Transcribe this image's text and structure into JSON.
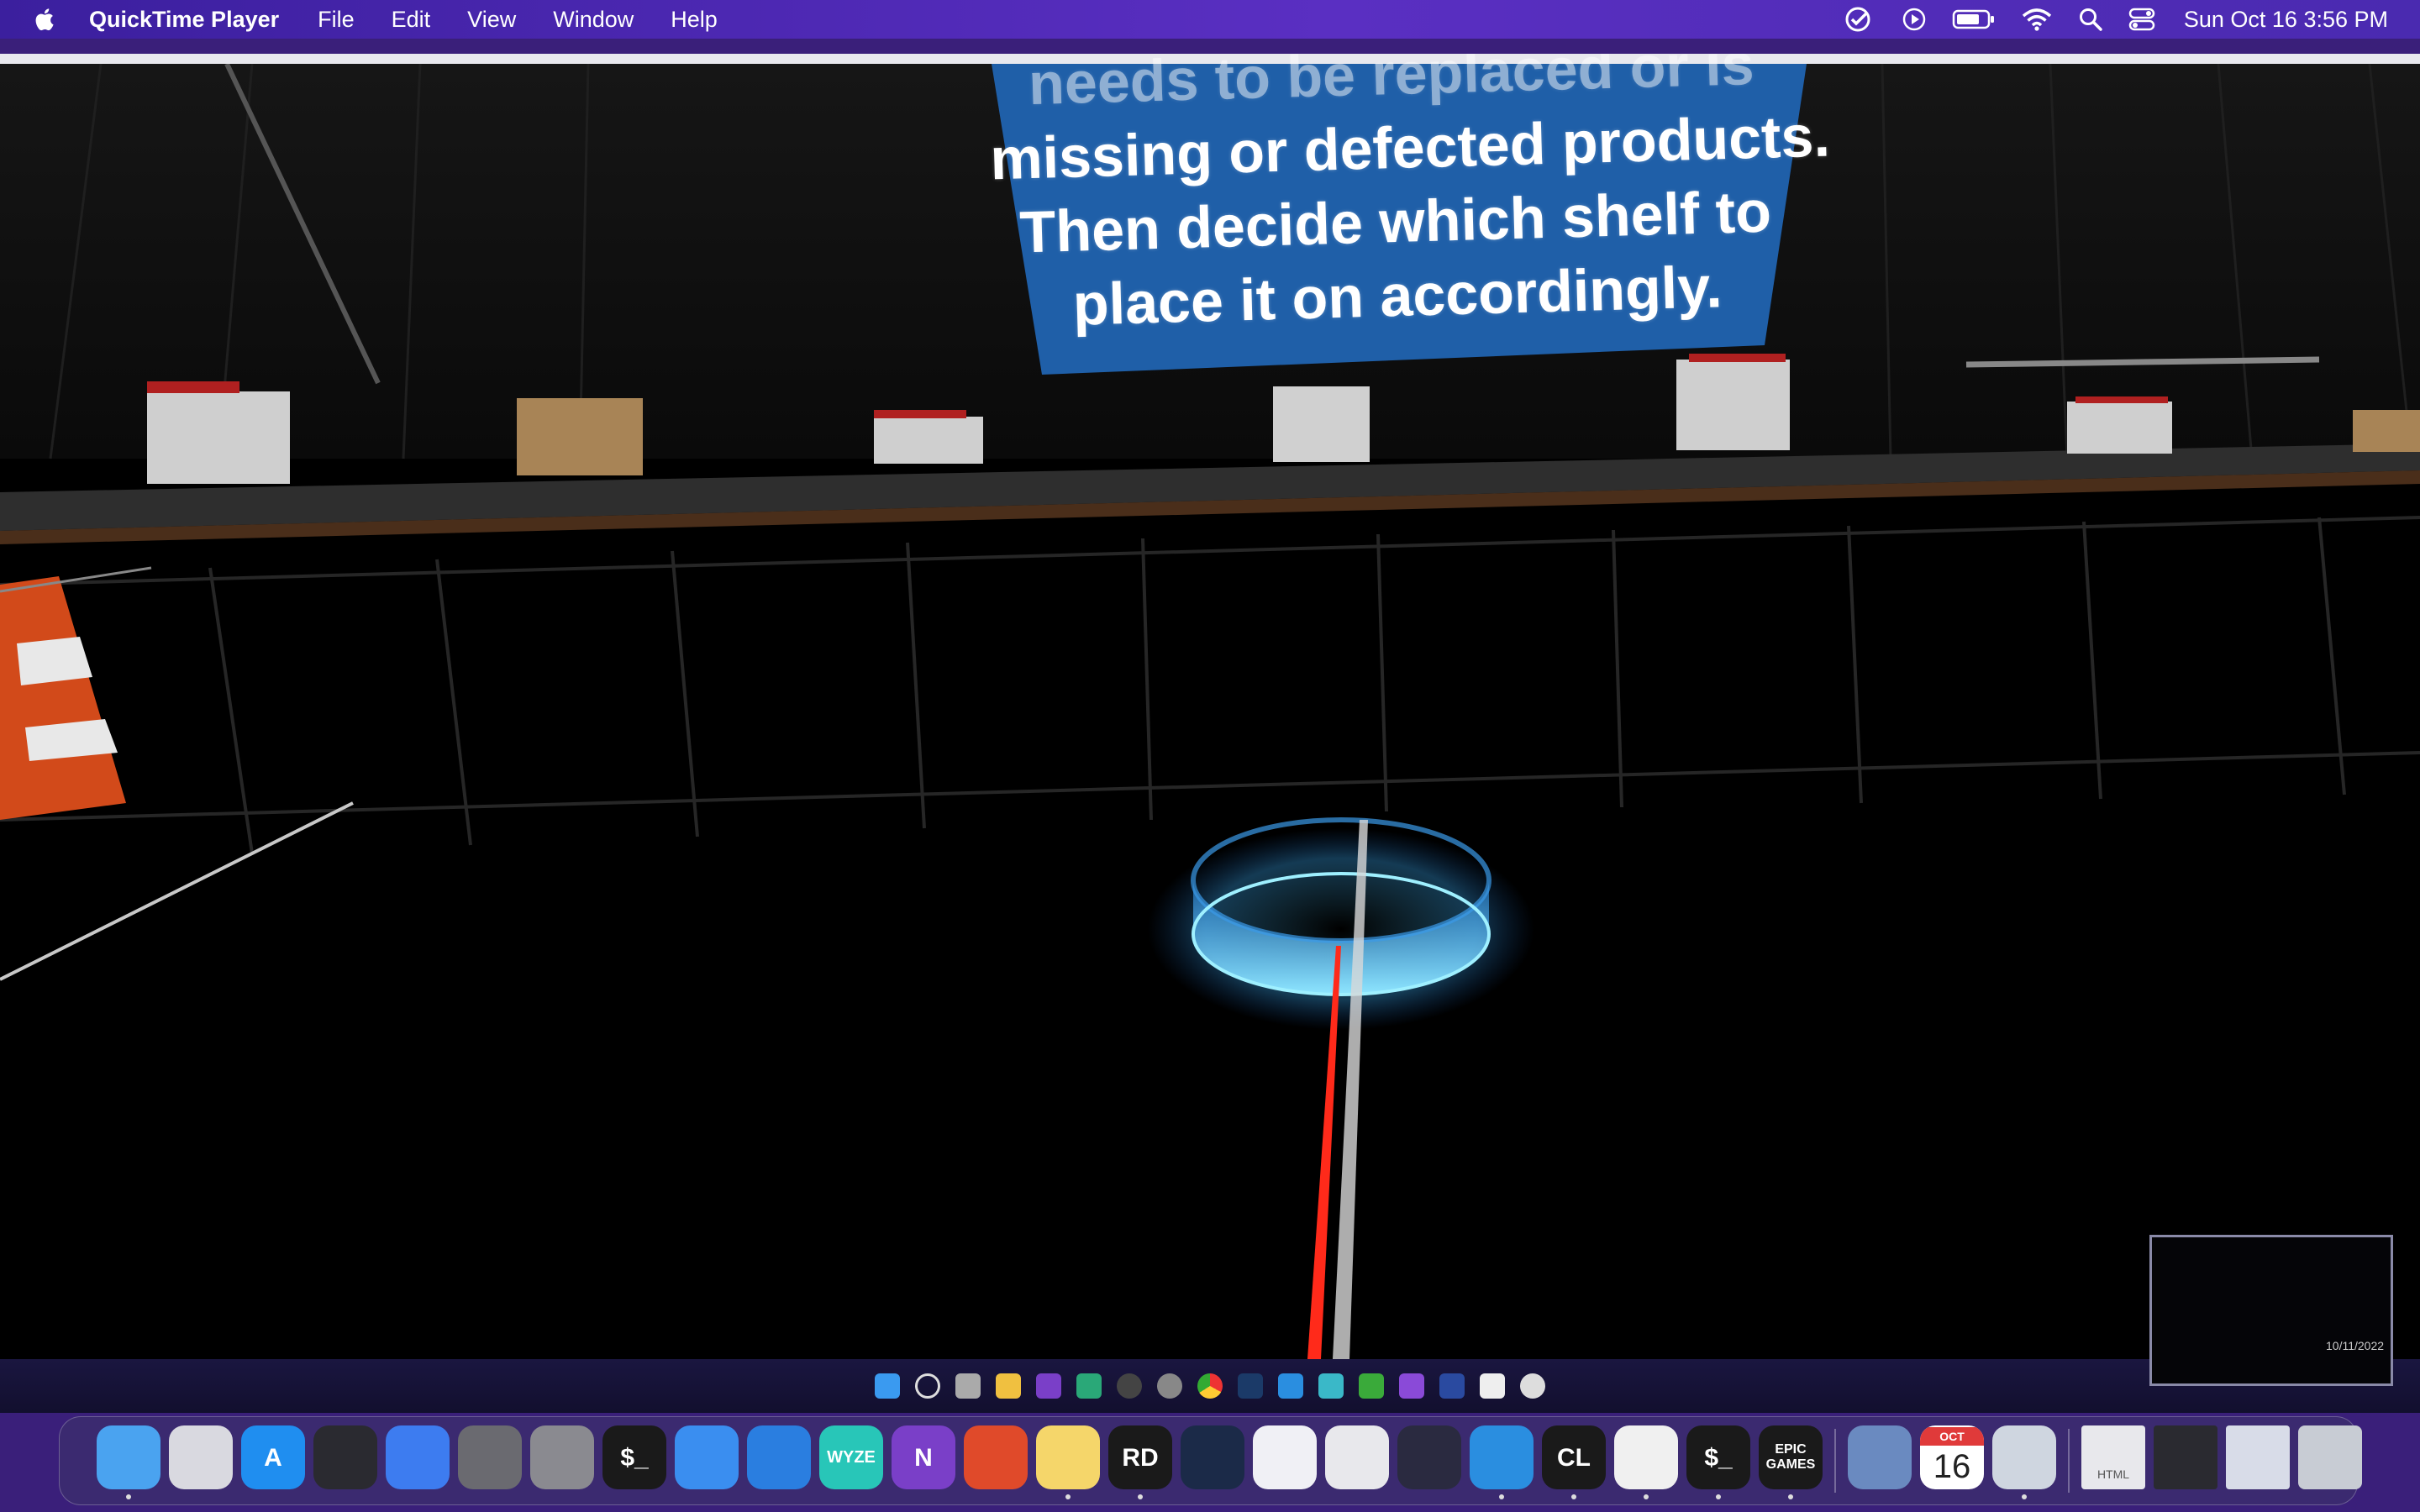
{
  "menubar": {
    "app_name": "QuickTime Player",
    "menus": [
      "File",
      "Edit",
      "View",
      "Window",
      "Help"
    ],
    "clock": "Sun Oct 16  3:56 PM",
    "status_icons": [
      "checklist-icon",
      "play-circle-icon",
      "battery-icon",
      "wifi-icon",
      "spotlight-search-icon",
      "control-center-icon"
    ]
  },
  "video": {
    "sign_lines": [
      "needs to be replaced or is",
      "missing or defected products.",
      "Then decide which shelf to",
      "place it on accordingly."
    ],
    "thumbnail_date": "10/11/2022"
  },
  "taskbar_icons": [
    "windows-start-icon",
    "windows-search-icon",
    "task-view-icon",
    "file-explorer-icon",
    "onenote-icon",
    "app-icon",
    "obs-icon",
    "app-icon",
    "chrome-icon",
    "steam-icon",
    "vscode-icon",
    "app-icon",
    "rider-icon",
    "visual-studio-icon",
    "powershell-icon",
    "oculus-icon",
    "unreal-engine-icon"
  ],
  "dock": {
    "apps": [
      {
        "name": "Finder",
        "icon": "finder-icon",
        "label": "",
        "color": "#4aa3f0",
        "running": true
      },
      {
        "name": "Launchpad",
        "icon": "launchpad-icon",
        "label": "",
        "color": "#d9d9e0",
        "running": false
      },
      {
        "name": "App Store",
        "icon": "app-store-icon",
        "label": "A",
        "color": "#1f8ef0",
        "running": false
      },
      {
        "name": "Compressor",
        "icon": "compressor-icon",
        "label": "",
        "color": "#2a2a30",
        "running": false
      },
      {
        "name": "Swift Playgrounds",
        "icon": "swift-icon",
        "label": "",
        "color": "#3d7cf0",
        "running": false
      },
      {
        "name": "Preview",
        "icon": "preview-icon",
        "label": "",
        "color": "#6a6a70",
        "running": false
      },
      {
        "name": "System Preferences",
        "icon": "gear-icon",
        "label": "",
        "color": "#8a8a90",
        "running": false
      },
      {
        "name": "Terminal",
        "icon": "terminal-icon",
        "label": "$_",
        "color": "#1a1a1a",
        "running": false
      },
      {
        "name": "Xcode Instruments",
        "icon": "instruments-icon",
        "label": "",
        "color": "#3a8ef0",
        "running": false
      },
      {
        "name": "Xcode",
        "icon": "xcode-icon",
        "label": "",
        "color": "#2a7ee0",
        "running": false
      },
      {
        "name": "Wyze",
        "icon": "wyze-icon",
        "label": "WYZE",
        "color": "#28c6b8",
        "running": false
      },
      {
        "name": "OneNote",
        "icon": "onenote-icon",
        "label": "N",
        "color": "#7a3fc8",
        "running": false
      },
      {
        "name": "Remote Desktop",
        "icon": "remote-desktop-icon",
        "label": "",
        "color": "#e04a2a",
        "running": false
      },
      {
        "name": "Notes",
        "icon": "notes-icon",
        "label": "",
        "color": "#f5d66a",
        "running": true
      },
      {
        "name": "Rider",
        "icon": "rider-icon",
        "label": "RD",
        "color": "#1a1a1a",
        "running": true
      },
      {
        "name": "Steam",
        "icon": "steam-icon",
        "label": "",
        "color": "#1b2a48",
        "running": false
      },
      {
        "name": "Xcode Accessibility",
        "icon": "accessibility-icon",
        "label": "",
        "color": "#f0f0f5",
        "running": false
      },
      {
        "name": "Unity",
        "icon": "unity-icon",
        "label": "",
        "color": "#e8e8ec",
        "running": false
      },
      {
        "name": "Unity Hub",
        "icon": "unity-hub-icon",
        "label": "",
        "color": "#2a2a40",
        "running": false
      },
      {
        "name": "Visual Studio Code",
        "icon": "vscode-icon",
        "label": "",
        "color": "#2a8ee0",
        "running": true
      },
      {
        "name": "CLion",
        "icon": "clion-icon",
        "label": "CL",
        "color": "#1a1a1a",
        "running": true
      },
      {
        "name": "Google Chrome",
        "icon": "chrome-icon",
        "label": "",
        "color": "#f0f0f0",
        "running": true
      },
      {
        "name": "Terminal",
        "icon": "terminal-icon",
        "label": "$_",
        "color": "#1a1a1a",
        "running": true
      },
      {
        "name": "Epic Games Launcher",
        "icon": "epic-games-icon",
        "label": "EPIC GAMES",
        "color": "#1a1a1a",
        "running": true
      },
      {
        "name": "Preview",
        "icon": "preview-photos-icon",
        "label": "",
        "color": "#6a8ac0",
        "running": false
      },
      {
        "name": "Calendar",
        "icon": "calendar-icon",
        "label": "16",
        "month": "OCT",
        "color": "#ffffff",
        "running": false
      },
      {
        "name": "QuickTime Player",
        "icon": "quicktime-icon",
        "label": "",
        "color": "#cfd6e0",
        "running": true
      }
    ],
    "stack_items": [
      {
        "icon": "html-file-icon",
        "label": "HTML"
      },
      {
        "icon": "screenshot-vscode-icon",
        "label": ""
      },
      {
        "icon": "screenshot-chrome-icon",
        "label": ""
      },
      {
        "icon": "trash-icon",
        "label": ""
      }
    ]
  }
}
